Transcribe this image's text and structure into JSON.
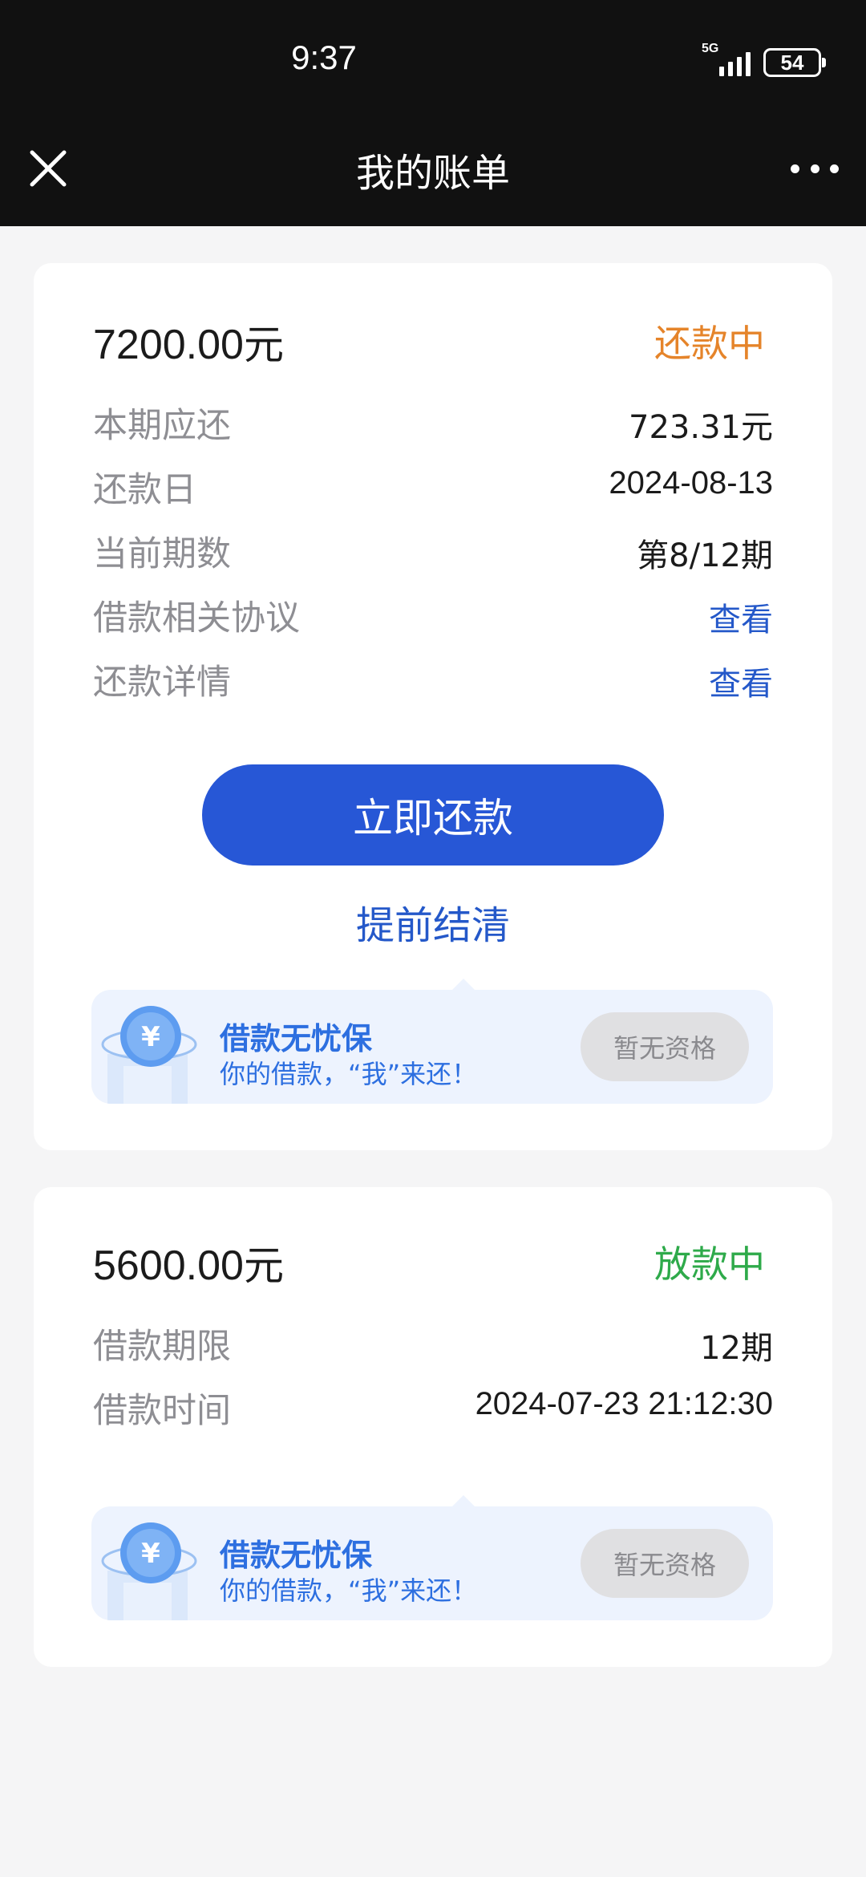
{
  "status_bar": {
    "time": "9:37",
    "network": "5G",
    "battery": "54"
  },
  "nav": {
    "title": "我的账单"
  },
  "bill_1": {
    "amount": "7200.00",
    "unit": "元",
    "status": "还款中",
    "status_color": "#e5842a",
    "rows": [
      {
        "label": "本期应还",
        "value": "723.31元"
      },
      {
        "label": "还款日",
        "value": "2024-08-13"
      },
      {
        "label": "当前期数",
        "value": "第8/12期"
      },
      {
        "label": "借款相关协议",
        "value": "查看"
      },
      {
        "label": "还款详情",
        "value": "查看"
      }
    ],
    "pay_button": "立即还款",
    "early_settle": "提前结清",
    "insurance": {
      "title": "借款无忧保",
      "subtitle": "你的借款，“我”来还！",
      "button": "暂无资格"
    }
  },
  "bill_2": {
    "amount": "5600.00",
    "unit": "元",
    "status": "放款中",
    "status_color": "#2eaa4a",
    "rows": [
      {
        "label": "借款期限",
        "value": "12期"
      },
      {
        "label": "借款时间",
        "value": "2024-07-23 21:12:30"
      }
    ],
    "insurance": {
      "title": "借款无忧保",
      "subtitle": "你的借款，“我”来还！",
      "button": "暂无资格"
    }
  },
  "colors": {
    "primary": "#2757d6",
    "link": "#2458c9",
    "header": "#111111"
  }
}
